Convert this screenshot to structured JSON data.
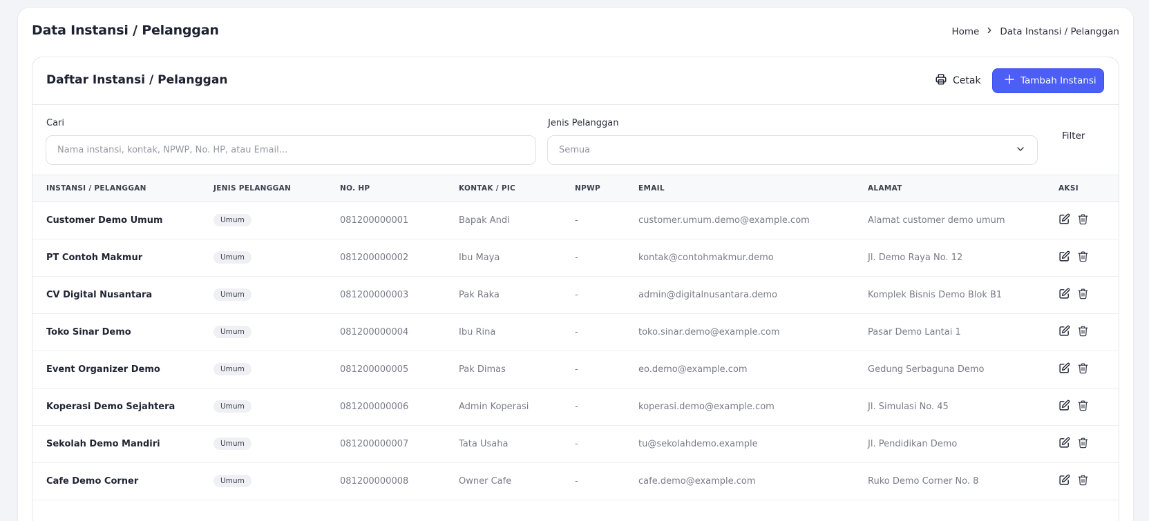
{
  "page": {
    "title": "Data Instansi / Pelanggan",
    "breadcrumb": {
      "home": "Home",
      "current": "Data Instansi / Pelanggan"
    }
  },
  "panel": {
    "title": "Daftar Instansi / Pelanggan",
    "print_label": "Cetak",
    "add_label": "Tambah Instansi"
  },
  "filters": {
    "search_label": "Cari",
    "search_placeholder": "Nama instansi, kontak, NPWP, No. HP, atau Email...",
    "type_label": "Jenis Pelanggan",
    "type_value": "Semua",
    "filter_label": "Filter"
  },
  "table": {
    "headers": [
      "INSTANSI / PELANGGAN",
      "JENIS PELANGGAN",
      "NO. HP",
      "KONTAK / PIC",
      "NPWP",
      "EMAIL",
      "ALAMAT",
      "AKSI"
    ],
    "rows": [
      {
        "name": "Customer Demo Umum",
        "type": "Umum",
        "phone": "081200000001",
        "contact": "Bapak Andi",
        "npwp": "-",
        "email": "customer.umum.demo@example.com",
        "address": "Alamat customer demo umum"
      },
      {
        "name": "PT Contoh Makmur",
        "type": "Umum",
        "phone": "081200000002",
        "contact": "Ibu Maya",
        "npwp": "-",
        "email": "kontak@contohmakmur.demo",
        "address": "Jl. Demo Raya No. 12"
      },
      {
        "name": "CV Digital Nusantara",
        "type": "Umum",
        "phone": "081200000003",
        "contact": "Pak Raka",
        "npwp": "-",
        "email": "admin@digitalnusantara.demo",
        "address": "Komplek Bisnis Demo Blok B1"
      },
      {
        "name": "Toko Sinar Demo",
        "type": "Umum",
        "phone": "081200000004",
        "contact": "Ibu Rina",
        "npwp": "-",
        "email": "toko.sinar.demo@example.com",
        "address": "Pasar Demo Lantai 1"
      },
      {
        "name": "Event Organizer Demo",
        "type": "Umum",
        "phone": "081200000005",
        "contact": "Pak Dimas",
        "npwp": "-",
        "email": "eo.demo@example.com",
        "address": "Gedung Serbaguna Demo"
      },
      {
        "name": "Koperasi Demo Sejahtera",
        "type": "Umum",
        "phone": "081200000006",
        "contact": "Admin Koperasi",
        "npwp": "-",
        "email": "koperasi.demo@example.com",
        "address": "Jl. Simulasi No. 45"
      },
      {
        "name": "Sekolah Demo Mandiri",
        "type": "Umum",
        "phone": "081200000007",
        "contact": "Tata Usaha",
        "npwp": "-",
        "email": "tu@sekolahdemo.example",
        "address": "Jl. Pendidikan Demo"
      },
      {
        "name": "Cafe Demo Corner",
        "type": "Umum",
        "phone": "081200000008",
        "contact": "Owner Cafe",
        "npwp": "-",
        "email": "cafe.demo@example.com",
        "address": "Ruko Demo Corner No. 8"
      }
    ]
  },
  "colors": {
    "accent": "#4c5ef6",
    "text": "#1f2433",
    "muted": "#777c88"
  }
}
